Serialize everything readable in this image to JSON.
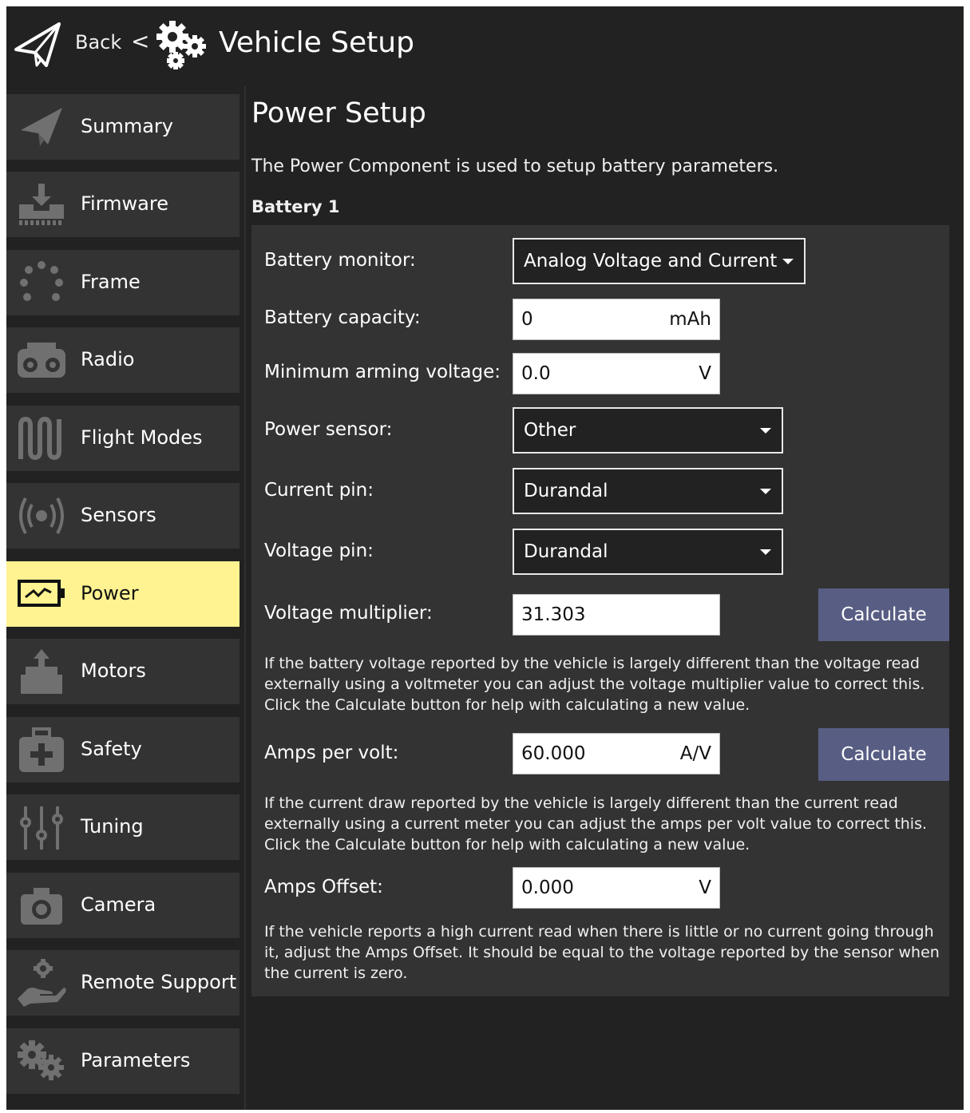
{
  "header": {
    "back_label": "Back",
    "separator": "<",
    "title": "Vehicle Setup"
  },
  "sidebar": {
    "items": [
      {
        "label": "Summary",
        "icon": "paper-plane-icon",
        "active": false
      },
      {
        "label": "Firmware",
        "icon": "download-chip-icon",
        "active": false
      },
      {
        "label": "Frame",
        "icon": "frame-dots-icon",
        "active": false
      },
      {
        "label": "Radio",
        "icon": "radio-transmitter-icon",
        "active": false
      },
      {
        "label": "Flight Modes",
        "icon": "waveform-icon",
        "active": false
      },
      {
        "label": "Sensors",
        "icon": "sensor-waves-icon",
        "active": false
      },
      {
        "label": "Power",
        "icon": "battery-icon",
        "active": true
      },
      {
        "label": "Motors",
        "icon": "motor-icon",
        "active": false
      },
      {
        "label": "Safety",
        "icon": "first-aid-icon",
        "active": false
      },
      {
        "label": "Tuning",
        "icon": "sliders-icon",
        "active": false
      },
      {
        "label": "Camera",
        "icon": "camera-icon",
        "active": false
      },
      {
        "label": "Remote Support",
        "icon": "hand-gear-icon",
        "active": false
      },
      {
        "label": "Parameters",
        "icon": "gears-icon",
        "active": false
      }
    ]
  },
  "main": {
    "title": "Power Setup",
    "description": "The Power Component is used to setup battery parameters.",
    "section_title": "Battery 1",
    "battery_monitor": {
      "label": "Battery monitor:",
      "value": "Analog Voltage and Current"
    },
    "battery_capacity": {
      "label": "Battery capacity:",
      "value": "0",
      "unit": "mAh"
    },
    "min_arming_voltage": {
      "label": "Minimum arming voltage:",
      "value": "0.0",
      "unit": "V"
    },
    "power_sensor": {
      "label": "Power sensor:",
      "value": "Other"
    },
    "current_pin": {
      "label": "Current pin:",
      "value": "Durandal"
    },
    "voltage_pin": {
      "label": "Voltage pin:",
      "value": "Durandal"
    },
    "voltage_multiplier": {
      "label": "Voltage multiplier:",
      "value": "31.303",
      "button": "Calculate",
      "help": "If the battery voltage reported by the vehicle is largely different than the voltage read externally using a voltmeter you can adjust the voltage multiplier value to correct this. Click the Calculate button for help with calculating a new value."
    },
    "amps_per_volt": {
      "label": "Amps per volt:",
      "value": "60.000",
      "unit": "A/V",
      "button": "Calculate",
      "help": "If the current draw reported by the vehicle is largely different than the current read externally using a current meter you can adjust the amps per volt value to correct this. Click the Calculate button for help with calculating a new value."
    },
    "amps_offset": {
      "label": "Amps Offset:",
      "value": "0.000",
      "unit": "V",
      "help": "If the vehicle reports a high current read when there is little or no current going through it, adjust the Amps Offset. It should be equal to the voltage reported by the sensor when the current is zero."
    }
  },
  "colors": {
    "background": "#222222",
    "panel": "#333333",
    "active_item": "#fff291",
    "button": "#585d83"
  }
}
